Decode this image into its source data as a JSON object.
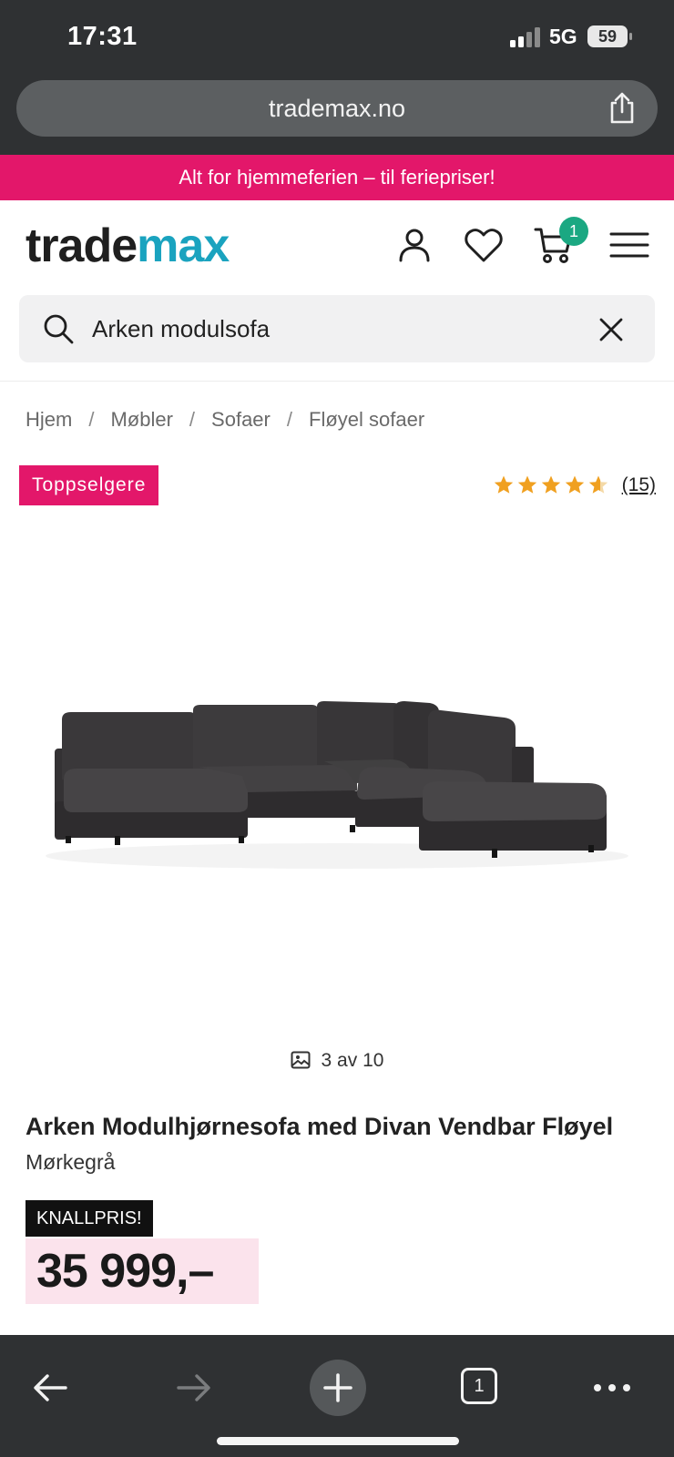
{
  "status": {
    "time": "17:31",
    "network": "5G",
    "battery": "59"
  },
  "browser": {
    "url": "trademax.no"
  },
  "promo": {
    "text": "Alt for hjemmeferien – til feriepriser!"
  },
  "header": {
    "logo_part1": "trade",
    "logo_part2": "max",
    "cart_count": "1"
  },
  "search": {
    "value": "Arken modulsofa"
  },
  "breadcrumb": {
    "items": [
      "Hjem",
      "Møbler",
      "Sofaer",
      "Fløyel sofaer"
    ],
    "separator": "/"
  },
  "badge": {
    "label": "Toppselgere"
  },
  "rating": {
    "stars": 4.5,
    "count": "(15)"
  },
  "gallery": {
    "counter": "3 av 10"
  },
  "product": {
    "title": "Arken Modulhjørnesofa med Divan Vendbar Fløyel",
    "variant": "Mørkegrå",
    "price_label": "KNALLPRIS!",
    "price": "35 999,–"
  },
  "toolbar": {
    "tab_count": "1"
  },
  "colors": {
    "brand_pink": "#e3176a",
    "brand_teal": "#1aa3bf",
    "cart_badge": "#1ba882",
    "chrome": "#2f3133",
    "star": "#f0a020"
  }
}
